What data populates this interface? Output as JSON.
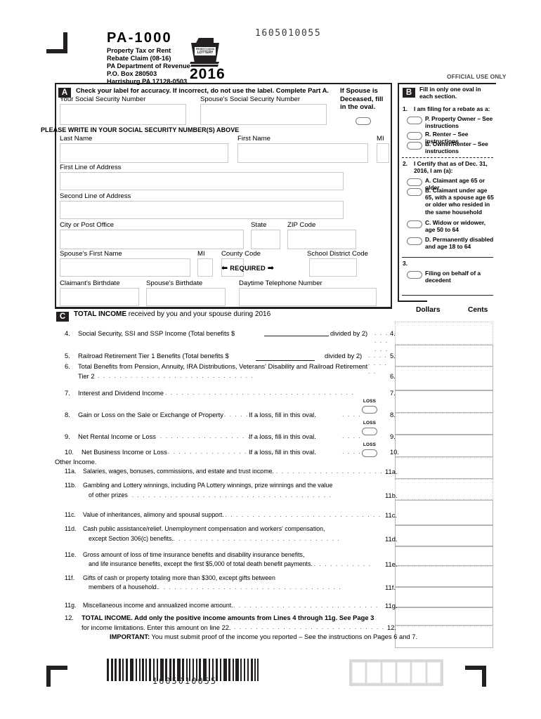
{
  "form": {
    "number": "PA-1000",
    "title_line1": "Property Tax or Rent",
    "title_line2": "Rebate Claim (08-16)",
    "agency": "PA Department of Revenue",
    "po_box": "P.O. Box 280503",
    "city_state_zip": "Harrisburg PA 17128-0503",
    "year": "2016",
    "tracking_number": "1605010055",
    "logo_text_top": "PENNSYLVANIA",
    "logo_text_main": "LOTTERY",
    "official_use": "OFFICIAL USE ONLY"
  },
  "part_a": {
    "letter": "A",
    "instruction": "Check your label for accuracy. If incorrect, do not use the label. Complete Part A.",
    "ssn_note": "PLEASE WRITE IN YOUR SOCIAL SECURITY NUMBER(S) ABOVE",
    "required_note": "REQUIRED",
    "fields": {
      "your_ssn": "Your Social Security Number",
      "spouse_ssn": "Spouse's Social Security Number",
      "last_name": "Last Name",
      "first_name": "First Name",
      "mi": "MI",
      "address1": "First Line of Address",
      "address2": "Second Line of Address",
      "city": "City or Post Office",
      "state": "State",
      "zip": "ZIP Code",
      "spouse_first_name": "Spouse's First Name",
      "spouse_mi": "MI",
      "county_code": "County Code",
      "school_district_code": "School District Code",
      "claimant_birthdate": "Claimant's Birthdate",
      "spouse_birthdate": "Spouse's Birthdate",
      "daytime_phone": "Daytime Telephone Number"
    },
    "deceased": {
      "line1": "If Spouse is",
      "line2": "Deceased, fill",
      "line3": "in the oval."
    }
  },
  "part_b": {
    "letter": "B",
    "instruction": "Fill in only one oval in each section.",
    "q1": {
      "number": "1.",
      "text": "I am filing for a rebate as a:"
    },
    "q1_options": [
      "P. Property Owner – See instructions",
      "R. Renter – See instructions",
      "B. Owner/Renter – See instructions"
    ],
    "q2": {
      "number": "2.",
      "text": "I Certify that as of Dec. 31, 2016, I am (a):"
    },
    "q2_options": [
      "A. Claimant age 65 or older",
      "B. Claimant under age 65, with a spouse age 65 or older who resided in the same household",
      "C. Widow or widower, age 50 to 64",
      "D. Permanently disabled and age 18 to 64"
    ],
    "q3": {
      "number": "3.",
      "text": "Filing on behalf of a decedent"
    }
  },
  "part_c": {
    "letter": "C",
    "heading_bold": "TOTAL INCOME",
    "heading_rest": " received by you and your spouse during 2016",
    "col_dollars": "Dollars",
    "col_cents": "Cents",
    "other_income_label": "Other Income.",
    "loss_label": "LOSS",
    "lines": [
      {
        "num": "4.",
        "text": "Social Security, SSI and SSP Income (Total benefits $",
        "text2": "divided by 2)",
        "ref": "4."
      },
      {
        "num": "5.",
        "text": "Railroad Retirement Tier 1 Benefits (Total benefits $",
        "text2": "divided by 2)",
        "ref": "5."
      },
      {
        "num": "6.",
        "text": "Total Benefits from Pension, Annuity, IRA Distributions, Veterans' Disability and Railroad Retirement",
        "text2": "Tier 2",
        "ref": "6."
      },
      {
        "num": "7.",
        "text": "Interest and Dividend Income",
        "ref": "7."
      },
      {
        "num": "8.",
        "text": "Gain or Loss on the Sale or Exchange of Property",
        "text2": "If a loss, fill in this oval.",
        "ref": "8."
      },
      {
        "num": "9.",
        "text": "Net Rental Income or Loss",
        "text2": "If a loss, fill in this oval.",
        "ref": "9."
      },
      {
        "num": "10.",
        "text": "Net Business Income or Loss",
        "text2": "If a loss, fill in this oval.",
        "ref": "10."
      },
      {
        "num": "11a.",
        "text": "Salaries, wages, bonuses, commissions, and estate and trust income.",
        "ref": "11a."
      },
      {
        "num": "11b.",
        "text": "Gambling and Lottery winnings, including PA Lottery winnings, prize winnings and the value",
        "text2": "of other prizes",
        "ref": "11b."
      },
      {
        "num": "11c.",
        "text": "Value of inheritances, alimony and spousal support.",
        "ref": "11c."
      },
      {
        "num": "11d.",
        "text": "Cash public assistance/relief.  Unemployment compensation and workers' compensation,",
        "text2": "except Section 306(c) benefits.",
        "ref": "11d."
      },
      {
        "num": "11e.",
        "text": "Gross amount of loss of time insurance benefits and disability insurance benefits,",
        "text2": "and life insurance benefits, except the first $5,000 of total death benefit payments.",
        "ref": "11e."
      },
      {
        "num": "11f.",
        "text": "Gifts of cash or property totaling more than $300, except gifts between",
        "text2": "members of a household.",
        "ref": "11f."
      },
      {
        "num": "11g.",
        "text": "Miscellaneous income and annualized income amount.",
        "ref": "11g."
      },
      {
        "num": "12.",
        "text": "TOTAL INCOME. Add only the positive income amounts from Lines 4 through 11g. See Page 3",
        "text2": "for income limitations. Enter this amount on line 22.",
        "ref": "12."
      }
    ]
  },
  "footer": {
    "important_bold": "IMPORTANT:",
    "important_text": " You must submit proof of the income you reported – See the instructions on Pages 6 and 7.",
    "barcode_number": "1605010055"
  },
  "colors": {
    "ink": "#231f20",
    "box_border": "#c9c9c9",
    "amount_border": "#b4b4b4"
  }
}
